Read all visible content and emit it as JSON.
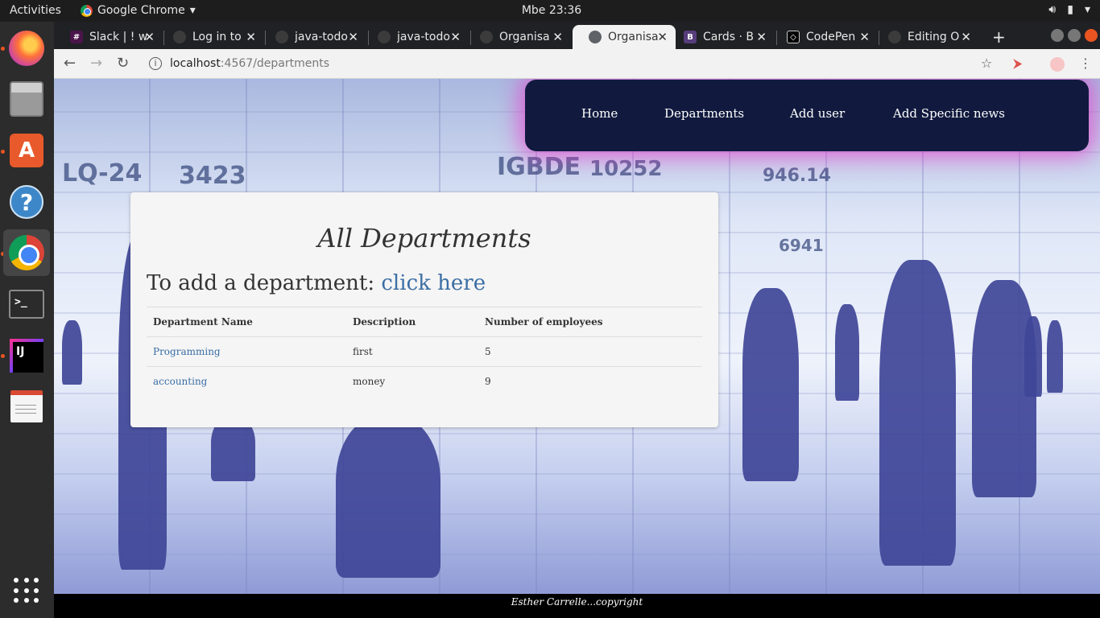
{
  "topbar": {
    "activities": "Activities",
    "app_name": "Google Chrome",
    "clock": "Mbe 23:36"
  },
  "dock": {
    "items": [
      "firefox",
      "files",
      "ubuntu-software",
      "help",
      "chrome",
      "terminal",
      "intellij",
      "text-editor",
      "show-applications"
    ]
  },
  "tabs": [
    {
      "title": "Slack | ! w",
      "icon": "slack-icon",
      "color": "#4a154b"
    },
    {
      "title": "Log in to",
      "icon": "github-icon",
      "color": "#3b3b3b"
    },
    {
      "title": "java-todo",
      "icon": "github-icon",
      "color": "#3b3b3b"
    },
    {
      "title": "java-todo",
      "icon": "github-icon",
      "color": "#3b3b3b"
    },
    {
      "title": "Organisa",
      "icon": "github-icon",
      "color": "#3b3b3b"
    },
    {
      "title": "Organisa",
      "icon": "globe-icon",
      "color": "#5f6368"
    },
    {
      "title": "Cards · B",
      "icon": "bootstrap-icon",
      "color": "#563d7c"
    },
    {
      "title": "CodePen",
      "icon": "codepen-icon",
      "color": "#000000"
    },
    {
      "title": "Editing O",
      "icon": "github-icon",
      "color": "#3b3b3b"
    }
  ],
  "address": {
    "host": "localhost",
    "path": ":4567/departments"
  },
  "nav": {
    "home": "Home",
    "departments": "Departments",
    "add_user": "Add user",
    "add_news": "Add Specific news"
  },
  "page": {
    "title": "All Departments",
    "add_prefix": "To add a department: ",
    "add_link": "click here",
    "columns": [
      "Department Name",
      "Description",
      "Number of employees"
    ],
    "rows": [
      {
        "name": "Programming",
        "description": "first",
        "employees": "5"
      },
      {
        "name": "accounting",
        "description": "money",
        "employees": "9"
      }
    ]
  },
  "background_text": {
    "t1": "LQ-24",
    "t2": "3423",
    "t3": "IGBDE",
    "t4": "10252",
    "t5": "946.14",
    "t6": "6941"
  },
  "footer": {
    "text": "Esther Carrelle...copyright"
  },
  "colors": {
    "navbar": "#111a3e",
    "navbar_glow": "#f028c8",
    "link": "#3b6ea5",
    "card": "#f5f5f5"
  }
}
